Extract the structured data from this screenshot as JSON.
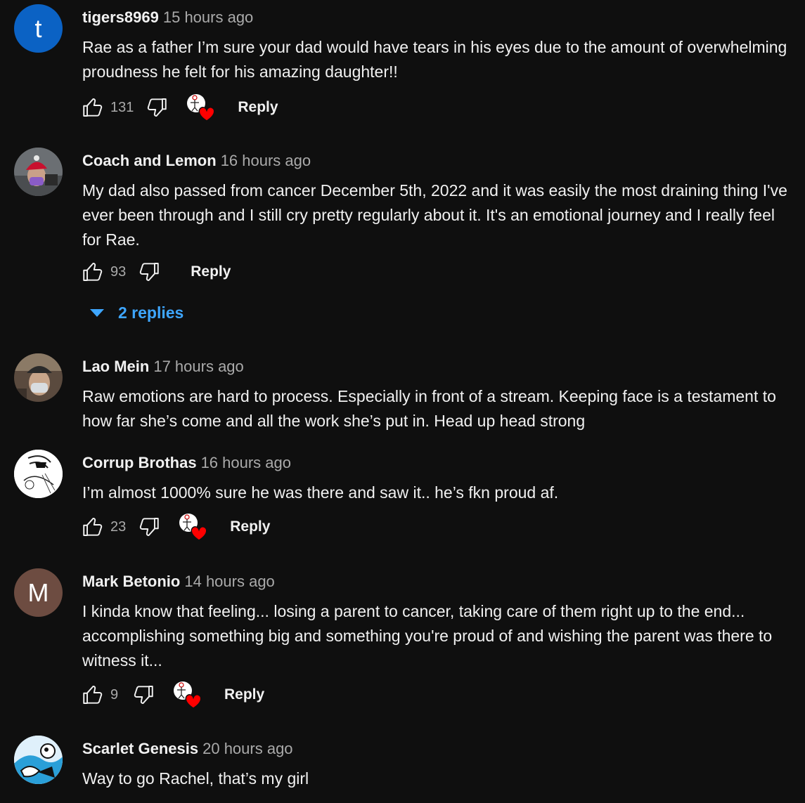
{
  "comments": [
    {
      "author": "tigers8969",
      "time": "15 hours ago",
      "text": "Rae as a father I’m sure your dad would have tears in his eyes due to the amount of overwhelming proudness he felt for his amazing daughter!!",
      "likes": "131",
      "reply_label": "Reply",
      "avatar_letter": "t",
      "avatar_color": "#0b62c4"
    },
    {
      "author": "Coach and Lemon",
      "time": "16 hours ago",
      "text": "My dad also passed from cancer December 5th, 2022 and it was easily the most draining thing I've ever been through and I still cry pretty regularly about it. It's an emotional journey and I really feel for Rae.",
      "likes": "93",
      "reply_label": "Reply",
      "replies_label": "2 replies"
    },
    {
      "author": "Lao Mein",
      "time": "17 hours ago",
      "text": "Raw emotions are hard to process. Especially in front of a stream. Keeping face is a testament to how far she’s come and all the work she’s put in. Head up head strong"
    },
    {
      "author": "Corrup Brothas",
      "time": "16 hours ago",
      "text": "I’m almost 1000% sure he was there and saw it.. he’s fkn proud af.",
      "likes": "23",
      "reply_label": "Reply"
    },
    {
      "author": "Mark Betonio",
      "time": "14 hours ago",
      "text": "I kinda know that feeling... losing a parent to cancer, taking care of them right up to the end... accomplishing something big and something you're proud of and wishing the parent was there to witness it...",
      "likes": "9",
      "reply_label": "Reply",
      "avatar_letter": "M",
      "avatar_color": "#6d4c41"
    },
    {
      "author": "Scarlet Genesis",
      "time": "20 hours ago",
      "text": "Way to go Rachel, that’s my girl"
    }
  ],
  "icons": {
    "like": "thumbs-up-icon",
    "dislike": "thumbs-down-icon",
    "creator_heart": "creator-heart-icon",
    "expand": "caret-down-icon"
  },
  "colors": {
    "background": "#0f0f0f",
    "link": "#3ea6ff",
    "heart": "#ff0000"
  }
}
